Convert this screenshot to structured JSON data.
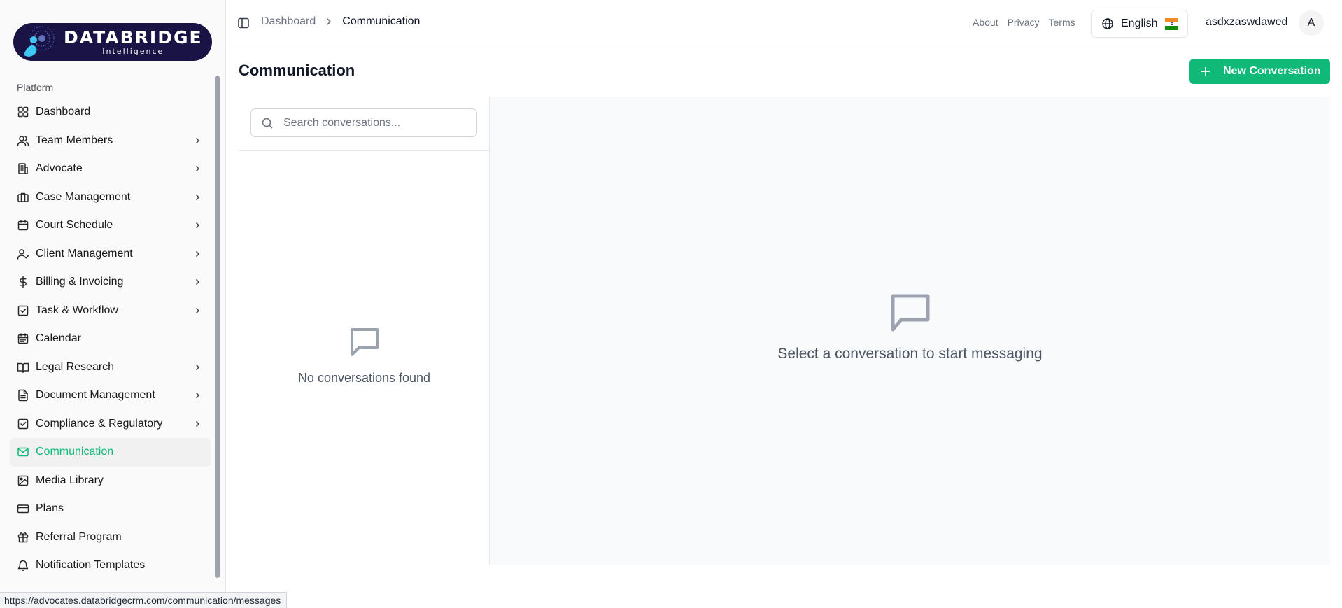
{
  "app": {
    "logo_title": "DATABRIDGE",
    "logo_subtitle": "Intelligence"
  },
  "sidebar": {
    "group_label": "Platform",
    "items": [
      {
        "label": "Dashboard",
        "icon": "layout-grid-icon",
        "expandable": false,
        "active": false
      },
      {
        "label": "Team Members",
        "icon": "users-icon",
        "expandable": true,
        "active": false
      },
      {
        "label": "Advocate",
        "icon": "building-icon",
        "expandable": true,
        "active": false
      },
      {
        "label": "Case Management",
        "icon": "briefcase-icon",
        "expandable": true,
        "active": false
      },
      {
        "label": "Court Schedule",
        "icon": "calendar-icon",
        "expandable": true,
        "active": false
      },
      {
        "label": "Client Management",
        "icon": "user-check-icon",
        "expandable": true,
        "active": false
      },
      {
        "label": "Billing & Invoicing",
        "icon": "dollar-icon",
        "expandable": true,
        "active": false
      },
      {
        "label": "Task & Workflow",
        "icon": "checkbox-icon",
        "expandable": true,
        "active": false
      },
      {
        "label": "Calendar",
        "icon": "calendar-days-icon",
        "expandable": false,
        "active": false
      },
      {
        "label": "Legal Research",
        "icon": "book-open-icon",
        "expandable": true,
        "active": false
      },
      {
        "label": "Document Management",
        "icon": "file-text-icon",
        "expandable": true,
        "active": false
      },
      {
        "label": "Compliance & Regulatory",
        "icon": "checkbox-icon",
        "expandable": true,
        "active": false
      },
      {
        "label": "Communication",
        "icon": "mail-icon",
        "expandable": false,
        "active": true
      },
      {
        "label": "Media Library",
        "icon": "image-icon",
        "expandable": false,
        "active": false
      },
      {
        "label": "Plans",
        "icon": "credit-card-icon",
        "expandable": false,
        "active": false
      },
      {
        "label": "Referral Program",
        "icon": "gift-icon",
        "expandable": false,
        "active": false
      },
      {
        "label": "Notification Templates",
        "icon": "bell-icon",
        "expandable": false,
        "active": false
      }
    ]
  },
  "header": {
    "breadcrumb": {
      "parent": "Dashboard",
      "current": "Communication"
    },
    "links": {
      "about": "About",
      "privacy": "Privacy",
      "terms": "Terms"
    },
    "language": "English",
    "username": "asdxzaswdawed",
    "avatar_initial": "A"
  },
  "main": {
    "title": "Communication",
    "new_button_label": "New Conversation",
    "search_placeholder": "Search conversations...",
    "list_empty_text": "No conversations found",
    "chat_empty_text": "Select a conversation to start messaging"
  },
  "status_bar": {
    "url": "https://advocates.databridgecrm.com/communication/messages"
  },
  "colors": {
    "accent": "#10b978",
    "sidebar_bg": "#fafafa",
    "logo_bg": "#1a1446",
    "panel_bg": "#f9fafb"
  }
}
